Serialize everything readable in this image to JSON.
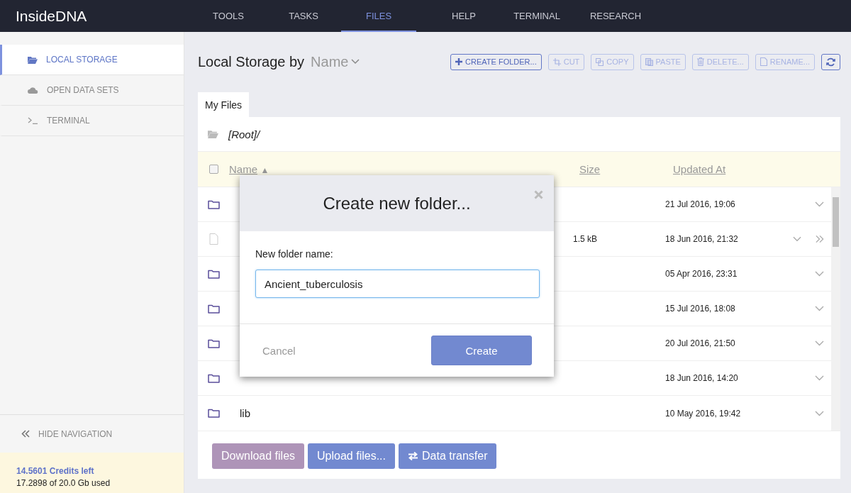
{
  "app": {
    "logo": "InsideDNA"
  },
  "nav": [
    {
      "label": "TOOLS",
      "selected": false
    },
    {
      "label": "TASKS",
      "selected": false
    },
    {
      "label": "FILES",
      "selected": true
    },
    {
      "label": "HELP",
      "selected": false
    },
    {
      "label": "TERMINAL",
      "selected": false
    },
    {
      "label": "RESEARCH",
      "selected": false
    }
  ],
  "sidebar": {
    "items": [
      {
        "label": "LOCAL STORAGE",
        "kind": "folder",
        "selected": true
      },
      {
        "label": "OPEN DATA SETS",
        "kind": "cloud",
        "selected": false
      },
      {
        "label": "TERMINAL",
        "kind": "terminal",
        "selected": false
      }
    ],
    "hide_navigation": "HIDE NAVIGATION",
    "credits": "14.5601 Credits left",
    "usage": "17.2898 of 20.0 Gb used"
  },
  "heading": {
    "title": "Local Storage by",
    "sort": "Name"
  },
  "toolbar": [
    {
      "label": "CREATE FOLDER...",
      "kind": "create",
      "disabled": false
    },
    {
      "label": "CUT",
      "kind": "cut",
      "disabled": true
    },
    {
      "label": "COPY",
      "kind": "copy",
      "disabled": true
    },
    {
      "label": "PASTE",
      "kind": "paste",
      "disabled": true
    },
    {
      "label": "DELETE...",
      "kind": "delete",
      "disabled": true
    },
    {
      "label": "RENAME...",
      "kind": "rename",
      "disabled": true
    },
    {
      "kind": "refresh",
      "disabled": false
    }
  ],
  "tabs": [
    {
      "label": "My Files",
      "selected": true
    }
  ],
  "breadcrumb": "[Root]/",
  "table": {
    "columns": [
      "Name",
      "Size",
      "Updated At"
    ],
    "sort_mark": "▲",
    "all_checked": false,
    "rows": [
      {
        "kind": "folder",
        "date": "21 Jul 2016, 19:06"
      },
      {
        "kind": "file",
        "size": "1.5 kB",
        "date": "18 Jun 2016, 21:32"
      },
      {
        "kind": "folder",
        "date": "05 Apr 2016, 23:31"
      },
      {
        "kind": "folder",
        "date": "15 Jul 2016, 18:08"
      },
      {
        "kind": "folder",
        "date": "20 Jul 2016, 21:50"
      },
      {
        "kind": "folder",
        "date": "18 Jun 2016, 14:20"
      },
      {
        "kind": "folder",
        "name": "lib",
        "date": "10 May 2016, 19:42"
      }
    ]
  },
  "actions": [
    {
      "label": "Download files",
      "kind": "download",
      "color": "#ae94b8"
    },
    {
      "label": "Upload files...",
      "kind": "upload",
      "color": "#7289d0"
    },
    {
      "label": "Data transfer",
      "kind": "transfer",
      "color": "#7289d0"
    }
  ],
  "dialog": {
    "title": "Create new folder...",
    "field_label": "New folder name:",
    "value": "Ancient_tuberculosis",
    "cancel": "Cancel",
    "submit": "Create"
  }
}
